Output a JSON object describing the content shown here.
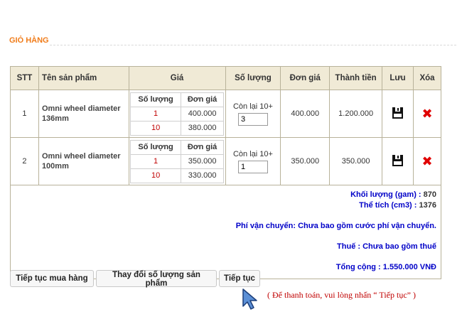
{
  "page": {
    "title": "GIỎ HÀNG"
  },
  "cart": {
    "headers": {
      "stt": "STT",
      "product": "Tên sản phẩm",
      "price": "Giá",
      "quantity": "Số lượng",
      "unit_price": "Đơn giá",
      "total": "Thành tiền",
      "save": "Lưu",
      "delete": "Xóa"
    },
    "price_table_headers": {
      "qty": "Số lượng",
      "unit": "Đơn giá"
    },
    "items": [
      {
        "stt": "1",
        "name": "Omni wheel diameter 136mm",
        "tiers": [
          {
            "qty": "1",
            "price": "400.000"
          },
          {
            "qty": "10",
            "price": "380.000"
          }
        ],
        "stock": "Còn lại 10+",
        "quantity": "3",
        "unit_price": "400.000",
        "total": "1.200.000"
      },
      {
        "stt": "2",
        "name": "Omni wheel diameter 100mm",
        "tiers": [
          {
            "qty": "1",
            "price": "350.000"
          },
          {
            "qty": "10",
            "price": "330.000"
          }
        ],
        "stock": "Còn lại 10+",
        "quantity": "1",
        "unit_price": "350.000",
        "total": "350.000"
      }
    ],
    "summary": {
      "weight_label": "Khối lượng (gam) :",
      "weight_value": "870",
      "volume_label": "Thể tích (cm3) :",
      "volume_value": "1376",
      "shipping_label": "Phí vận chuyển: Chưa bao gồm cước phí vận chuyển.",
      "tax_label": "Thuế : Chưa bao gồm thuế",
      "total_label": "Tổng cộng : 1.550.000 VNĐ"
    }
  },
  "actions": {
    "continue_shopping": "Tiếp tục mua hàng",
    "update_quantity": "Thay đổi số lượng sản phẩm",
    "continue": "Tiếp tục",
    "hint": "( Để thanh toán, vui lòng nhấn “ Tiếp tục” )"
  },
  "icons": {
    "save": "floppy-disk-icon",
    "delete": "red-x-icon",
    "pointer": "mouse-cursor-icon"
  },
  "colors": {
    "title": "#f07c1a",
    "header_bg": "#f0ead6",
    "summary_label": "#0000c8",
    "accent_red": "#c00000",
    "delete_icon": "#e00000"
  }
}
